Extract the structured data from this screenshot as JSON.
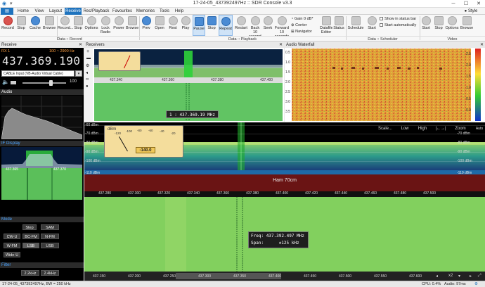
{
  "window": {
    "title": "17-24-05_437392497Hz :: SDR Console v3.3"
  },
  "menu": {
    "items": [
      "Home",
      "View",
      "Layout",
      "Receive",
      "Rec/Playback",
      "Favourites",
      "Memories",
      "Tools",
      "Help"
    ],
    "active": "Receive",
    "style": "Style"
  },
  "ribbon": {
    "buttons": [
      "Record",
      "Stop",
      "Cache",
      "Browse",
      "Record...",
      "Stop",
      "Options",
      "Lock Radio",
      "Power",
      "Browse",
      "Prev",
      "Open",
      "Rest",
      "Play",
      "Pause",
      "Stop",
      "Repeat",
      "Restart",
      "Back 10 seconds",
      "Seek",
      "Forward 10 seconds",
      "Datafile Editor",
      "Status",
      "Schedule",
      "Start",
      "Start",
      "Stop",
      "Options",
      "Browse"
    ],
    "gain": "Gain 0 dB*",
    "center": "Center",
    "navigator": "Navigator",
    "show_status": "Show in status bar",
    "start_auto": "Start automatically",
    "groups": [
      "Data :: Record",
      "Data :: Playback",
      "Data :: Scheduler",
      "Video"
    ]
  },
  "receive_panel": {
    "title": "Receive",
    "rx": "RX 1",
    "range": "100 ~ 2900 Hz",
    "frequency": "437.369.190",
    "input": "CABLE Input (VB-Audio Virtual Cable)",
    "volume": "100",
    "audio": "Audio",
    "display": "IF Display",
    "if_ticks": [
      "437.365",
      "437.370"
    ],
    "mode_title": "Mode",
    "modes": [
      "Step",
      "SAM",
      "CW-U",
      "BC-FM",
      "N-FM",
      "W-FM",
      "LSB",
      "USB",
      "Wide-U"
    ],
    "selected_mode": "LSB",
    "filter_title": "Filter",
    "filters": [
      "2.2kHz",
      "2.4kHz"
    ]
  },
  "receivers": {
    "title": "Receivers",
    "ticks": [
      "437.340",
      "437.360",
      "437.380",
      "437.400"
    ],
    "label": "1 : 437.369.19 MHz"
  },
  "waterfall": {
    "title": "Audio Waterfall",
    "left_ticks": [
      "0.5",
      "1.0",
      "1.5",
      "2.0",
      "2.5",
      "3.0",
      "3.5"
    ],
    "right_ticks": [
      "2.5",
      "2.0",
      "1.5",
      "1.0",
      "0.5",
      "0.0"
    ]
  },
  "spectrum": {
    "db_ticks": [
      "-60 dBm",
      "-70 dBm",
      "-80 dBm",
      "-90 dBm",
      "-100 dBm",
      "-110 dBm"
    ],
    "tools": [
      "Scale...",
      "Low",
      "High",
      "Zoom"
    ],
    "meter_value": "-140.0",
    "meter_unit": "dBm",
    "meter_scale": [
      "-120",
      "-100",
      "-80",
      "-60",
      "-40",
      "-20"
    ],
    "band": "Ham 70cm",
    "freq_ticks": [
      "437.280",
      "437.300",
      "437.320",
      "437.340",
      "437.360",
      "437.380",
      "437.400",
      "437.420",
      "437.440",
      "437.460",
      "437.480",
      "437.500"
    ],
    "auto": "Auto",
    "lower_ticks": [
      "437.150",
      "437.200",
      "437.250",
      "437.300",
      "437.350",
      "437.400",
      "437.450",
      "437.500",
      "437.550",
      "437.600"
    ],
    "info_freq_label": "Freq:",
    "info_freq": "437.392.497 MHz",
    "info_span_label": "Span:",
    "info_span": "±125 kHz",
    "zoom": "x2"
  },
  "status": {
    "file": "17-24-05_437392497Hz, BW = 250 kHz",
    "cpu": "CPU: 0.4%",
    "audio": "Audio: 97ms"
  }
}
